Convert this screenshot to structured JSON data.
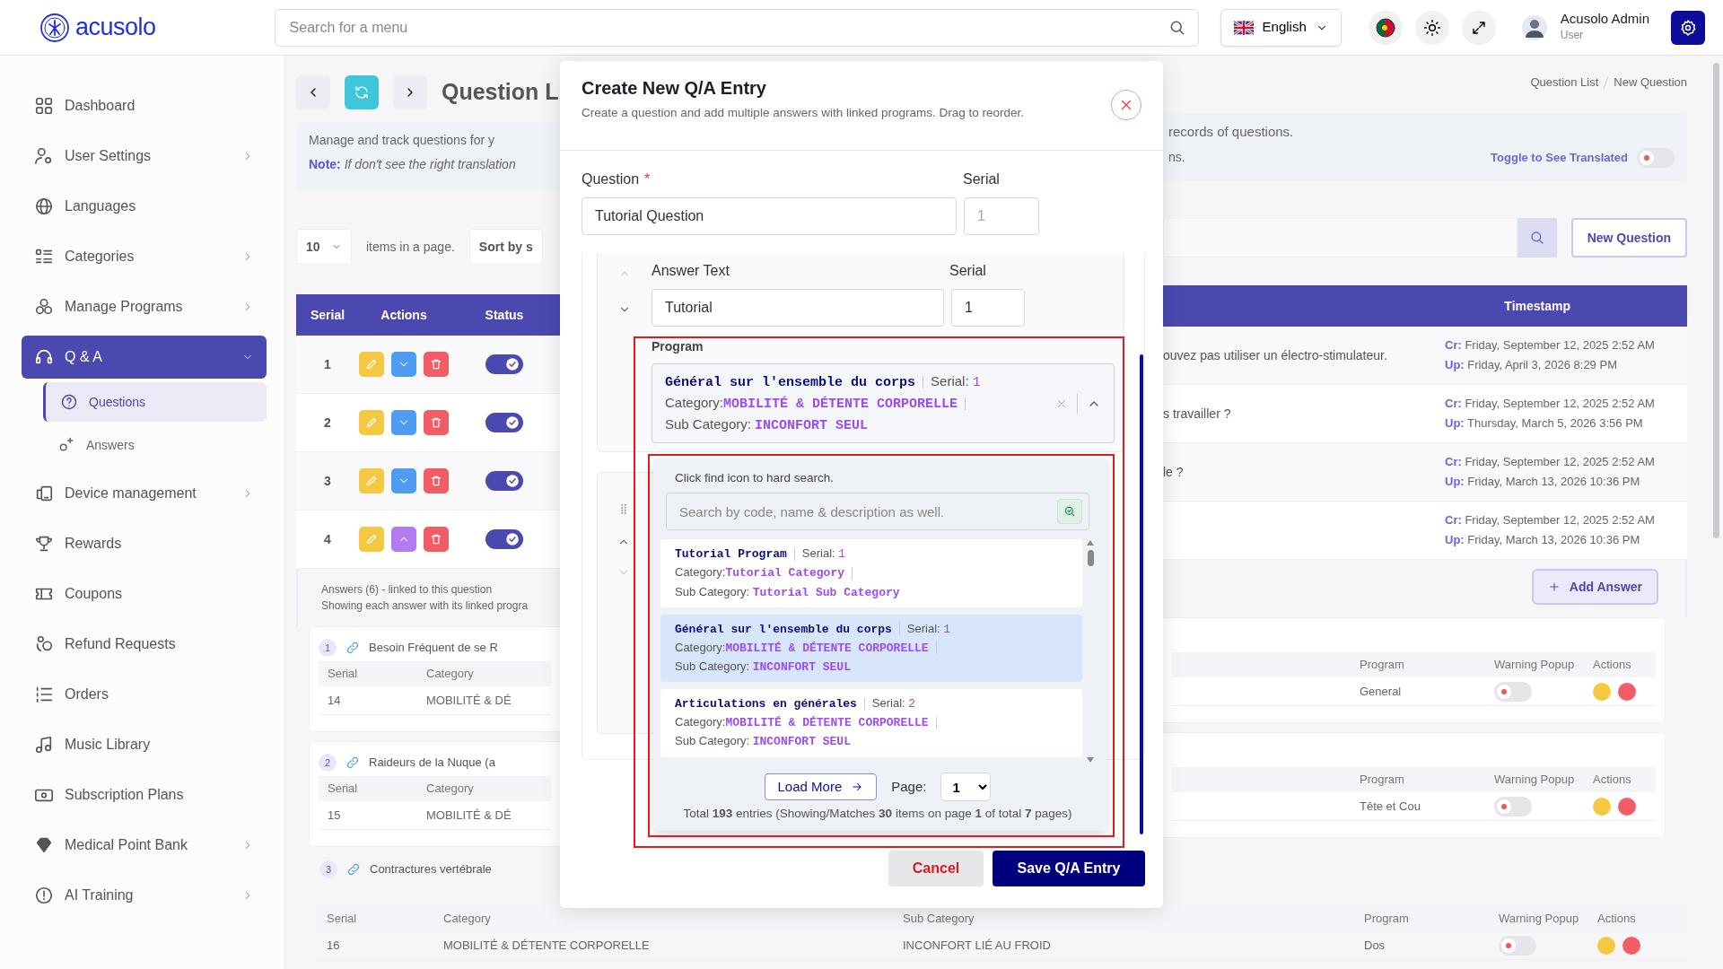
{
  "header": {
    "logo": "acusolo",
    "search_placeholder": "Search for a menu",
    "language": "English",
    "user_name": "Acusolo Admin",
    "user_role": "User"
  },
  "sidebar": {
    "items": [
      {
        "label": "Dashboard",
        "selected": false
      },
      {
        "label": "User Settings",
        "selected": false,
        "expanded": false
      },
      {
        "label": "Languages",
        "selected": false
      },
      {
        "label": "Categories",
        "selected": false,
        "expanded": false
      },
      {
        "label": "Manage Programs",
        "selected": false,
        "expanded": false
      },
      {
        "label": "Q & A",
        "selected": true,
        "expanded": true,
        "children": [
          {
            "label": "Questions",
            "selected": true
          },
          {
            "label": "Answers",
            "selected": false
          }
        ]
      },
      {
        "label": "Device management",
        "selected": false,
        "expanded": false
      },
      {
        "label": "Rewards",
        "selected": false
      },
      {
        "label": "Coupons",
        "selected": false
      },
      {
        "label": "Refund Requests",
        "selected": false
      },
      {
        "label": "Orders",
        "selected": false
      },
      {
        "label": "Music Library",
        "selected": false
      },
      {
        "label": "Subscription Plans",
        "selected": false
      },
      {
        "label": "Medical Point Bank",
        "selected": false,
        "expanded": false
      },
      {
        "label": "AI Training",
        "selected": false,
        "expanded": false
      }
    ]
  },
  "page": {
    "title": "Question L",
    "breadcrumb": [
      "Question List",
      "New Question"
    ],
    "info": {
      "text": "Manage and track questions for y",
      "note_label": "Note:",
      "note_text": "If don't see the right translation",
      "text_right": "records of questions.",
      "text_right_2": "ns.",
      "toggle_label": "Toggle to See Translated",
      "toggle_on": false
    },
    "page_size": "10",
    "page_size_label": "items in a page.",
    "sort": "Sort by s",
    "new_button": "New Question",
    "table": {
      "columns_left": [
        "Serial",
        "Actions",
        "Status"
      ],
      "columns_right": [
        "Timestamp"
      ],
      "rows": [
        {
          "serial": "1",
          "expanded": false,
          "status_on": true,
          "question": "ouvez pas utiliser un électro-stimulateur.",
          "created_label": "Cr:",
          "created": "Friday, September 12, 2025 2:52 AM",
          "updated_label": "Up:",
          "updated": "Friday, April 3, 2026 8:29 PM"
        },
        {
          "serial": "2",
          "expanded": false,
          "status_on": true,
          "question": "s travailler ?",
          "created_label": "Cr:",
          "created": "Friday, September 12, 2025 2:52 AM",
          "updated_label": "Up:",
          "updated": "Thursday, March 5, 2026 3:56 PM"
        },
        {
          "serial": "3",
          "expanded": false,
          "status_on": true,
          "question": "le ?",
          "created_label": "Cr:",
          "created": "Friday, September 12, 2025 2:52 AM",
          "updated_label": "Up:",
          "updated": "Friday, March 13, 2026 10:36 PM"
        },
        {
          "serial": "4",
          "expanded": true,
          "status_on": true,
          "created_label": "Cr:",
          "created": "Friday, September 12, 2025 2:52 AM",
          "updated_label": "Up:",
          "updated": "Friday, March 13, 2026 10:36 PM"
        }
      ]
    },
    "answers": {
      "title": "Answers (6) - linked to this question",
      "subtitle": "Showing each answer with its linked progra",
      "add_button": "Add Answer",
      "groups": [
        {
          "number": "1",
          "title": "Besoin Fréquent de se R",
          "columns_left": [
            "Serial",
            "Category"
          ],
          "columns_right": [
            "Program",
            "Warning Popup",
            "Actions"
          ],
          "serial": "14",
          "category": "MOBILITÉ & DÉ",
          "program": "General",
          "warning_on": false
        },
        {
          "number": "2",
          "title": "Raideurs de la Nuque (a",
          "columns_left": [
            "Serial",
            "Category"
          ],
          "columns_right": [
            "Program",
            "Warning Popup",
            "Actions"
          ],
          "serial": "15",
          "category": "MOBILITÉ & DÉ",
          "program": "Tête et Cou",
          "warning_on": false
        }
      ],
      "last_group": {
        "number": "3",
        "title": "Contractures vertébrale",
        "columns": [
          "Serial",
          "Category",
          "Sub Category",
          "Program",
          "Warning Popup",
          "Actions"
        ],
        "serial": "16",
        "category": "MOBILITÉ & DÉTENTE CORPORELLE",
        "sub_category": "INCONFORT LIÉ AU FROID",
        "program": "Dos",
        "warning_on": false
      }
    }
  },
  "modal": {
    "title": "Create New Q/A Entry",
    "subtitle": "Create a question and add multiple answers with linked programs. Drag to reorder.",
    "question_label": "Question",
    "required_mark": "*",
    "serial_label": "Serial",
    "question_value": "Tutorial Question",
    "serial_placeholder": "1",
    "answer": {
      "text_label": "Answer Text",
      "serial_label": "Serial",
      "text_value": "Tutorial",
      "serial_value": "1",
      "program_label": "Program",
      "program": {
        "name": "Général sur l'ensemble du corps",
        "serial_label": "Serial:",
        "serial": "1",
        "category_label": "Category:",
        "category": "MOBILITÉ & DÉTENTE CORPORELLE",
        "sub_category_label": "Sub Category:",
        "sub_category": "INCONFORT SEUL"
      },
      "dropdown": {
        "hint": "Click find icon to hard search.",
        "search_placeholder": "Search by code, name & description as well.",
        "options": [
          {
            "name": "Tutorial Program",
            "serial_label": "Serial:",
            "serial": "1",
            "category_label": "Category:",
            "category": "Tutorial Category",
            "sub_category_label": "Sub Category:",
            "sub_category": "Tutorial Sub Category",
            "selected": false
          },
          {
            "name": "Général sur l'ensemble du corps",
            "serial_label": "Serial:",
            "serial": "1",
            "category_label": "Category:",
            "category": "MOBILITÉ & DÉTENTE CORPORELLE",
            "sub_category_label": "Sub Category:",
            "sub_category": "INCONFORT SEUL",
            "selected": true
          },
          {
            "name": "Articulations en générales",
            "serial_label": "Serial:",
            "serial": "2",
            "category_label": "Category:",
            "category": "MOBILITÉ & DÉTENTE CORPORELLE",
            "sub_category_label": "Sub Category:",
            "sub_category": "INCONFORT SEUL",
            "selected": false
          }
        ],
        "load_more": "Load More",
        "page_label": "Page:",
        "page": "1",
        "total": "Total  **193** entries (Showing/Matches **30** items on page **1** of total **7** pages)"
      }
    },
    "cancel": "Cancel",
    "save": "Save Q/A Entry"
  }
}
